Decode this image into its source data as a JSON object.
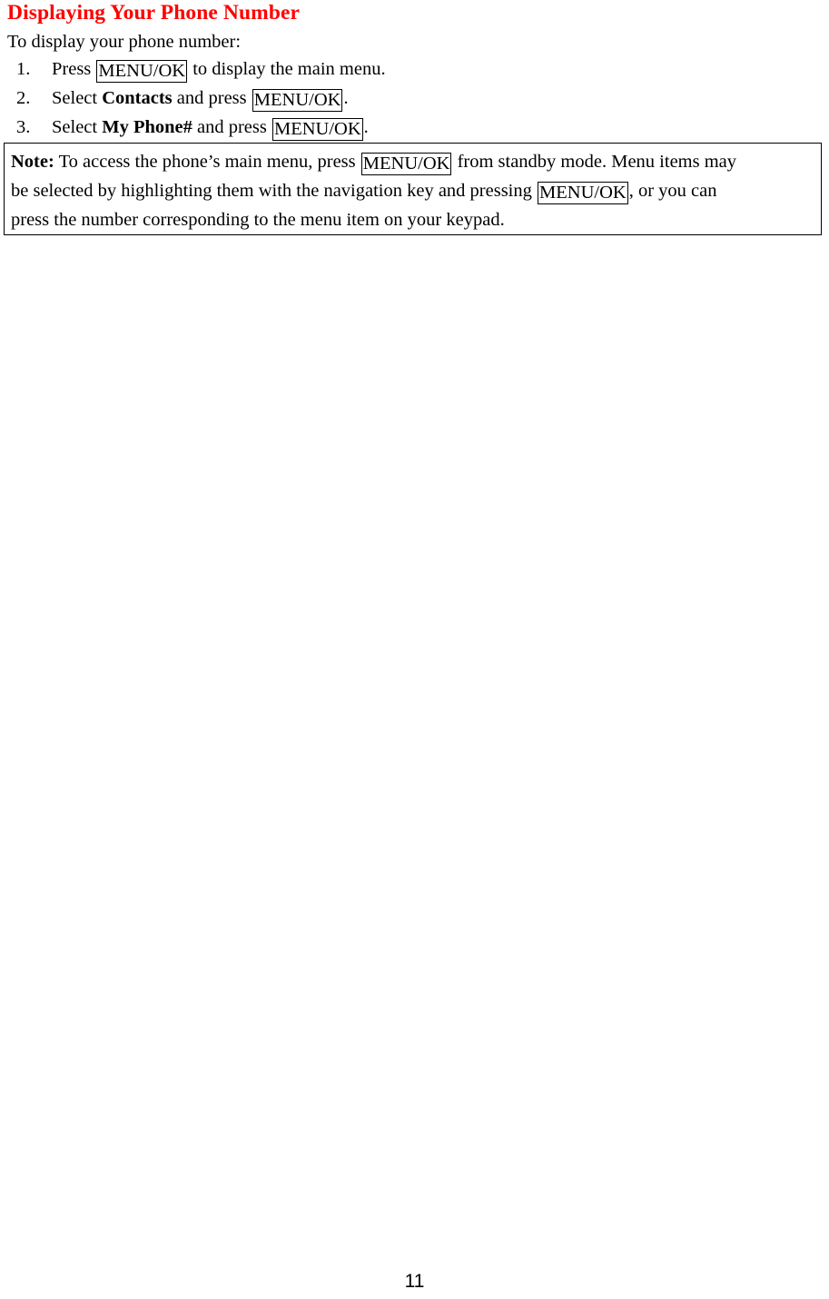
{
  "document": {
    "heading": "Displaying Your Phone Number",
    "heading_color": "#ff0000",
    "intro": "To display your phone number:",
    "key_label": "MENU/OK",
    "steps": [
      {
        "number": "1.",
        "pre": "Press",
        "key": "MENU/OK",
        "post": "to display the main menu.",
        "bold_term": "",
        "mid": ""
      },
      {
        "number": "2.",
        "pre": "Select",
        "bold_term": "Contacts",
        "mid": "and press",
        "key": "MENU/OK",
        "post": "."
      },
      {
        "number": "3.",
        "pre": "Select",
        "bold_term": "My Phone#",
        "mid": "and press",
        "key": "MENU/OK",
        "post": "."
      }
    ],
    "note": {
      "label": "Note:",
      "line1_pre": "To access the phone’s main menu, press",
      "line1_key": "MENU/OK",
      "line1_post": "from standby mode. Menu items may",
      "line2_pre": "be selected by highlighting them with the navigation key and pressing",
      "line2_key": "MENU/OK",
      "line2_post": ", or you can",
      "line3": "press the number corresponding to the menu item on your keypad."
    },
    "page_number": "11"
  }
}
